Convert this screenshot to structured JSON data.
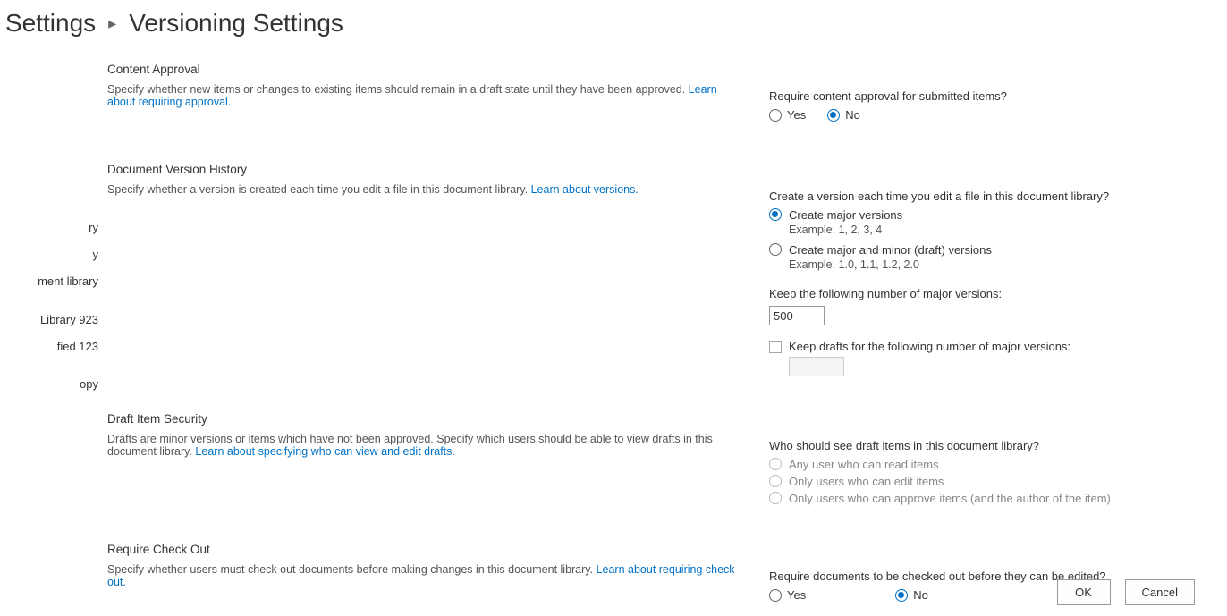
{
  "breadcrumb": {
    "parent": "Settings",
    "current": "Versioning Settings"
  },
  "leftNav": {
    "items": [
      "ry",
      "y",
      "ment library",
      "Library 923",
      "fied 123",
      "opy"
    ]
  },
  "sections": {
    "contentApproval": {
      "title": "Content Approval",
      "desc": "Specify whether new items or changes to existing items should remain in a draft state until they have been approved.  ",
      "learnLink": "Learn about requiring approval."
    },
    "versionHistory": {
      "title": "Document Version History",
      "desc": "Specify whether a version is created each time you edit a file in this document library.  ",
      "learnLink": "Learn about versions."
    },
    "draftSecurity": {
      "title": "Draft Item Security",
      "desc": "Drafts are minor versions or items which have not been approved. Specify which users should be able to view drafts in this document library.  ",
      "learnLink": "Learn about specifying who can view and edit drafts."
    },
    "requireCheckout": {
      "title": "Require Check Out",
      "desc": "Specify whether users must check out documents before making changes in this document library.  ",
      "learnLink": "Learn about requiring check out."
    }
  },
  "controls": {
    "approval": {
      "question": "Require content approval for submitted items?",
      "yes": "Yes",
      "no": "No",
      "selected": "No"
    },
    "versioning": {
      "question": "Create a version each time you edit a file in this document library?",
      "major": "Create major versions",
      "majorExample": "Example: 1, 2, 3, 4",
      "minor": "Create major and minor (draft) versions",
      "minorExample": "Example: 1.0, 1.1, 1.2, 2.0",
      "selected": "major",
      "keepMajorLabel": "Keep the following number of major versions:",
      "keepMajorValue": "500",
      "keepDraftsLabel": "Keep drafts for the following number of major versions:",
      "keepDraftsValue": ""
    },
    "draftView": {
      "question": "Who should see draft items in this document library?",
      "opt1": "Any user who can read items",
      "opt2": "Only users who can edit items",
      "opt3": "Only users who can approve items (and the author of the item)"
    },
    "checkout": {
      "question": "Require documents to be checked out before they can be edited?",
      "yes": "Yes",
      "no": "No",
      "selected": "No"
    }
  },
  "buttons": {
    "ok": "OK",
    "cancel": "Cancel"
  }
}
